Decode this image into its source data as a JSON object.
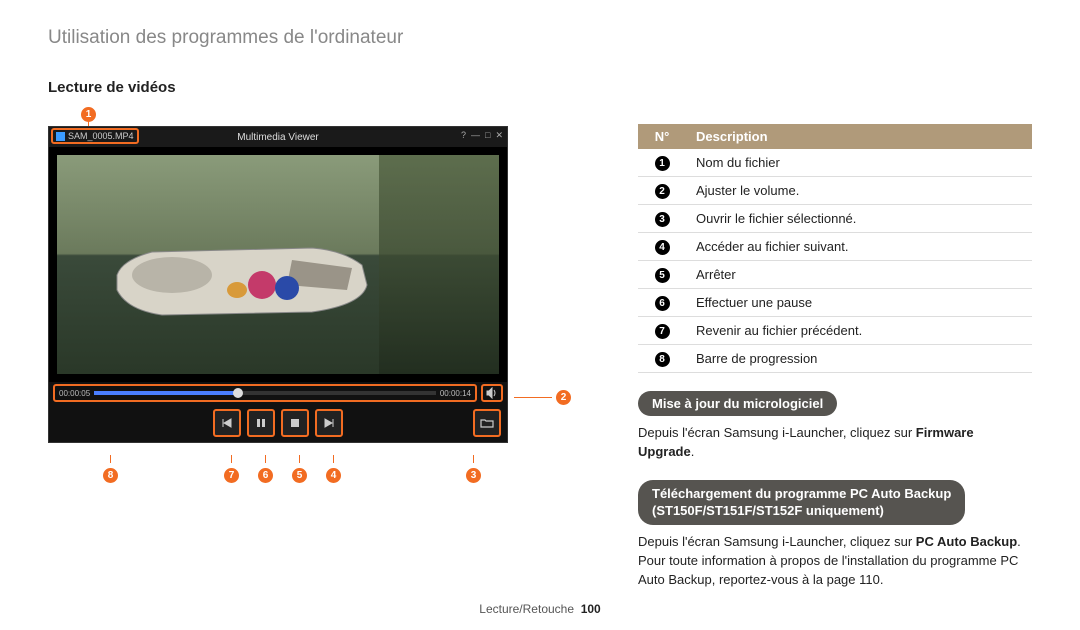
{
  "header": "Utilisation des programmes de l'ordinateur",
  "section_title": "Lecture de vidéos",
  "viewer": {
    "filename": "SAM_0005.MP4",
    "app_title": "Multimedia Viewer",
    "time_current": "00:00:05",
    "time_total": "00:00:14"
  },
  "callouts": {
    "c1": "1",
    "c2": "2",
    "c3": "3",
    "c4": "4",
    "c5": "5",
    "c6": "6",
    "c7": "7",
    "c8": "8"
  },
  "table": {
    "col_n": "N°",
    "col_desc": "Description",
    "rows": [
      {
        "n": "1",
        "d": "Nom du fichier"
      },
      {
        "n": "2",
        "d": "Ajuster le volume."
      },
      {
        "n": "3",
        "d": "Ouvrir le fichier sélectionné."
      },
      {
        "n": "4",
        "d": "Accéder au fichier suivant."
      },
      {
        "n": "5",
        "d": "Arrêter"
      },
      {
        "n": "6",
        "d": "Effectuer une pause"
      },
      {
        "n": "7",
        "d": "Revenir au fichier précédent."
      },
      {
        "n": "8",
        "d": "Barre de progression"
      }
    ]
  },
  "firmware": {
    "heading": "Mise à jour du micrologiciel",
    "text_a": "Depuis l'écran Samsung i-Launcher, cliquez sur ",
    "text_b": "Firmware Upgrade",
    "text_c": "."
  },
  "backup": {
    "heading_l1": "Téléchargement du programme PC Auto Backup",
    "heading_l2": "(ST150F/ST151F/ST152F uniquement)",
    "text_a": "Depuis l'écran Samsung i-Launcher, cliquez sur ",
    "text_b": "PC Auto Backup",
    "text_c": ". Pour toute information à propos de l'installation du programme PC Auto Backup, reportez-vous à la page 110."
  },
  "footer": {
    "section": "Lecture/Retouche",
    "page": "100"
  }
}
